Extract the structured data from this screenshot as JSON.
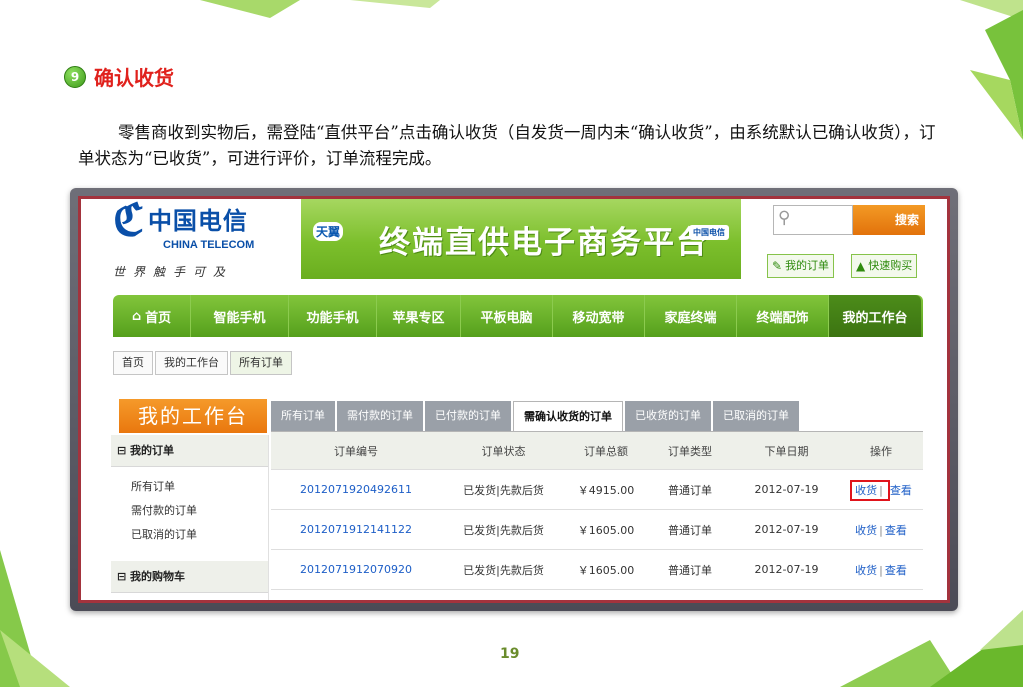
{
  "slide": {
    "step_number": "9",
    "title": "确认收货",
    "paragraph": "零售商收到实物后，需登陆“直供平台”点击确认收货（自发货一周内未“确认收货”，由系统默认已确认收货），订单状态为“已收货”，可进行评价，订单流程完成。",
    "page_number": "19"
  },
  "colors": {
    "accent_red": "#e0211c",
    "nav_green": "#55a01c",
    "orange": "#e9770e",
    "link_blue": "#1d5ec7"
  },
  "site": {
    "logo_cn": "中国电信",
    "logo_en": "CHINA TELECOM",
    "logo_slogan": "世界触手可及",
    "banner_brand": "天翼",
    "banner_title": "终端直供电子商务平台",
    "search_placeholder": "",
    "search_button": "搜索",
    "my_orders_link": "我的订单",
    "quick_buy_link": "快速购买"
  },
  "nav": {
    "items": [
      "首页",
      "智能手机",
      "功能手机",
      "苹果专区",
      "平板电脑",
      "移动宽带",
      "家庭终端",
      "终端配饰",
      "我的工作台"
    ],
    "active": "我的工作台"
  },
  "breadcrumb": [
    "首页",
    "我的工作台",
    "所有订单"
  ],
  "sidebar": {
    "title": "我的工作台",
    "group1": "我的订单",
    "links": [
      "所有订单",
      "需付款的订单",
      "已取消的订单"
    ],
    "group2": "我的购物车"
  },
  "tabs": {
    "items": [
      "所有订单",
      "需付款的订单",
      "已付款的订单",
      "需确认收货的订单",
      "已收货的订单",
      "已取消的订单"
    ],
    "active": "需确认收货的订单"
  },
  "orders": {
    "headers": [
      "订单编号",
      "订单状态",
      "订单总额",
      "订单类型",
      "下单日期",
      "操作"
    ],
    "rows": [
      {
        "id": "2012071920492611",
        "status": "已发货|先款后货",
        "total": "￥4915.00",
        "type": "普通订单",
        "date": "2012-07-19",
        "receive": "收货",
        "view": "查看"
      },
      {
        "id": "2012071912141122",
        "status": "已发货|先款后货",
        "total": "￥1605.00",
        "type": "普通订单",
        "date": "2012-07-19",
        "receive": "收货",
        "view": "查看"
      },
      {
        "id": "2012071912070920",
        "status": "已发货|先款后货",
        "total": "￥1605.00",
        "type": "普通订单",
        "date": "2012-07-19",
        "receive": "收货",
        "view": "查看"
      }
    ]
  }
}
